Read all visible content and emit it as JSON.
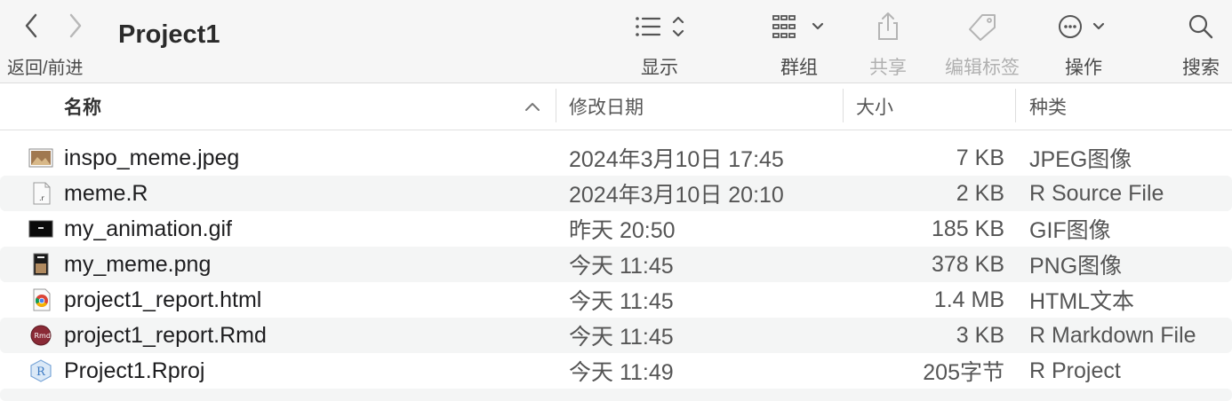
{
  "toolbar": {
    "nav_label": "返回/前进",
    "title": "Project1",
    "view_label": "显示",
    "group_label": "群组",
    "share_label": "共享",
    "tags_label": "编辑标签",
    "action_label": "操作",
    "search_label": "搜索"
  },
  "columns": {
    "name": "名称",
    "date": "修改日期",
    "size": "大小",
    "kind": "种类"
  },
  "files": [
    {
      "name": "inspo_meme.jpeg",
      "date": "2024年3月10日 17:45",
      "size": "7 KB",
      "kind": "JPEG图像",
      "icon": "jpeg-file-icon"
    },
    {
      "name": "meme.R",
      "date": "2024年3月10日 20:10",
      "size": "2 KB",
      "kind": "R Source File",
      "icon": "r-source-file-icon"
    },
    {
      "name": "my_animation.gif",
      "date": "昨天 20:50",
      "size": "185 KB",
      "kind": "GIF图像",
      "icon": "gif-file-icon"
    },
    {
      "name": "my_meme.png",
      "date": "今天 11:45",
      "size": "378 KB",
      "kind": "PNG图像",
      "icon": "png-file-icon"
    },
    {
      "name": "project1_report.html",
      "date": "今天 11:45",
      "size": "1.4 MB",
      "kind": "HTML文本",
      "icon": "chrome-html-icon"
    },
    {
      "name": "project1_report.Rmd",
      "date": "今天 11:45",
      "size": "3 KB",
      "kind": "R Markdown File",
      "icon": "rmd-file-icon"
    },
    {
      "name": "Project1.Rproj",
      "date": "今天 11:49",
      "size": "205字节",
      "kind": "R Project",
      "icon": "rproj-file-icon"
    }
  ]
}
